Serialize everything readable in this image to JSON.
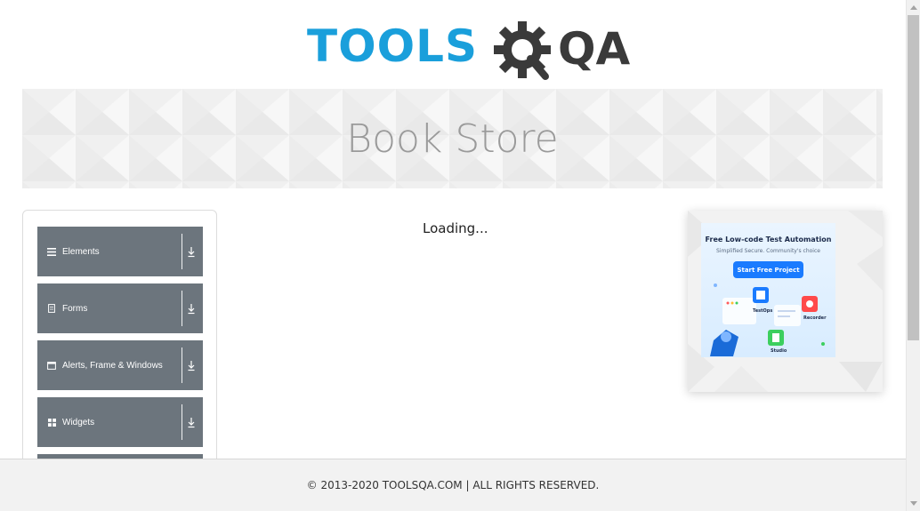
{
  "header": {
    "logo_text_main": "TOOLS",
    "logo_text_suffix": "QA",
    "logo_main_color": "#1a9fdb",
    "logo_suffix_color": "#3a3a3a"
  },
  "banner": {
    "title": "Book Store"
  },
  "sidebar": {
    "groups": [
      {
        "label": "Elements",
        "icon": "hamburger-icon"
      },
      {
        "label": "Forms",
        "icon": "document-icon"
      },
      {
        "label": "Alerts, Frame & Windows",
        "icon": "window-icon"
      },
      {
        "label": "Widgets",
        "icon": "grid-icon"
      }
    ],
    "group_color": "#6c757d"
  },
  "main": {
    "loading_text": "Loading..."
  },
  "ad": {
    "title": "Free Low-code Test Automation",
    "subtitle": "Simplified Secure. Community's choice",
    "button_label": "Start Free Project",
    "labels": [
      "TestOps",
      "Recorder",
      "Studio"
    ]
  },
  "footer": {
    "text": "© 2013-2020 TOOLSQA.COM | ALL RIGHTS RESERVED."
  }
}
